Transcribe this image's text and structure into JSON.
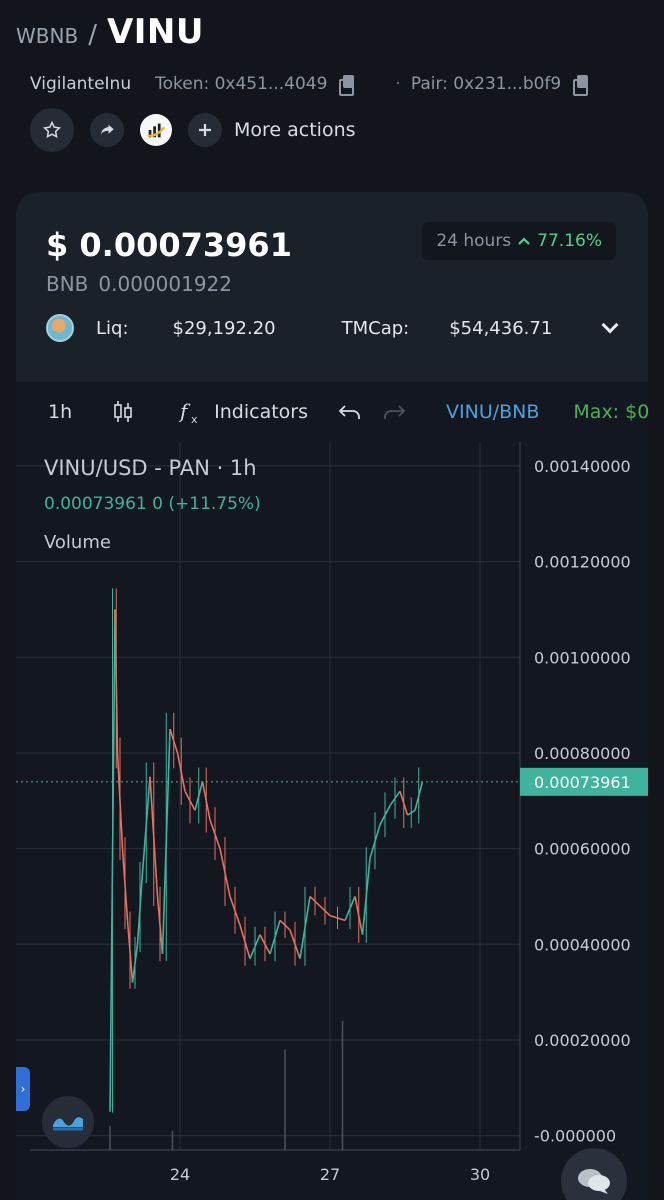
{
  "header": {
    "base_symbol": "WBNB",
    "separator": "/",
    "quote_symbol": "VINU"
  },
  "token_info": {
    "name": "VigilanteInu",
    "token_label": "Token: 0x451...4049",
    "pair_label": "Pair: 0x231...b0f9"
  },
  "actions": {
    "more_label": "More actions"
  },
  "price": {
    "usd": "$ 0.00073961",
    "bnb_label": "BNB",
    "bnb_value": "0.000001922",
    "change_period": "24 hours",
    "change_value": "77.16%",
    "liq_label": "Liq:",
    "liq_value": "$29,192.20",
    "tmcap_label": "TMCap:",
    "tmcap_value": "$54,436.71"
  },
  "toolbar": {
    "interval": "1h",
    "indicators_label": "Indicators",
    "pair_label": "VINU/BNB",
    "max_label": "Max: $0"
  },
  "chart_data": {
    "type": "candlestick",
    "title": "VINU/USD - PAN · 1h",
    "ohlc_readout": "0.00073961  0 (+11.75%)",
    "volume_label": "Volume",
    "y_ticks": [
      "0.00140000",
      "0.00120000",
      "0.00100000",
      "0.00080000",
      "0.00060000",
      "0.00040000",
      "0.00020000",
      "-0.000000"
    ],
    "ylim": [
      -3e-05,
      0.00145
    ],
    "x_ticks": [
      "24",
      "27",
      "30"
    ],
    "last_price": 0.00073961,
    "last_price_label": "0.00073961",
    "colors": {
      "up": "#3fb39d",
      "down": "#e5715f",
      "grid": "#2a303a",
      "axis_text": "#c5cbd2",
      "price_line": "#3fb39d"
    },
    "price_path": [
      [
        22.6,
        5e-05
      ],
      [
        22.7,
        0.0011
      ],
      [
        22.75,
        0.0008
      ],
      [
        22.85,
        0.0006
      ],
      [
        22.95,
        0.00045
      ],
      [
        23.05,
        0.00032
      ],
      [
        23.15,
        0.0004
      ],
      [
        23.25,
        0.00055
      ],
      [
        23.4,
        0.00075
      ],
      [
        23.55,
        0.0005
      ],
      [
        23.65,
        0.00038
      ],
      [
        23.8,
        0.00085
      ],
      [
        23.95,
        0.0008
      ],
      [
        24.1,
        0.00072
      ],
      [
        24.3,
        0.00068
      ],
      [
        24.45,
        0.00074
      ],
      [
        24.6,
        0.00066
      ],
      [
        24.8,
        0.0006
      ],
      [
        25.0,
        0.0005
      ],
      [
        25.2,
        0.00044
      ],
      [
        25.4,
        0.00037
      ],
      [
        25.6,
        0.00042
      ],
      [
        25.8,
        0.00038
      ],
      [
        26.0,
        0.00045
      ],
      [
        26.2,
        0.00043
      ],
      [
        26.4,
        0.00037
      ],
      [
        26.6,
        0.0005
      ],
      [
        26.8,
        0.00048
      ],
      [
        27.0,
        0.00046
      ],
      [
        27.3,
        0.00045
      ],
      [
        27.5,
        0.0005
      ],
      [
        27.65,
        0.00042
      ],
      [
        27.8,
        0.00058
      ],
      [
        28.0,
        0.00065
      ],
      [
        28.2,
        0.00069
      ],
      [
        28.4,
        0.00072
      ],
      [
        28.55,
        0.00067
      ],
      [
        28.7,
        0.00068
      ],
      [
        28.85,
        0.00074
      ]
    ],
    "volume_spikes": [
      [
        22.6,
        2e-05
      ],
      [
        23.85,
        1e-05
      ],
      [
        26.1,
        0.00018
      ],
      [
        27.25,
        0.00024
      ]
    ]
  }
}
